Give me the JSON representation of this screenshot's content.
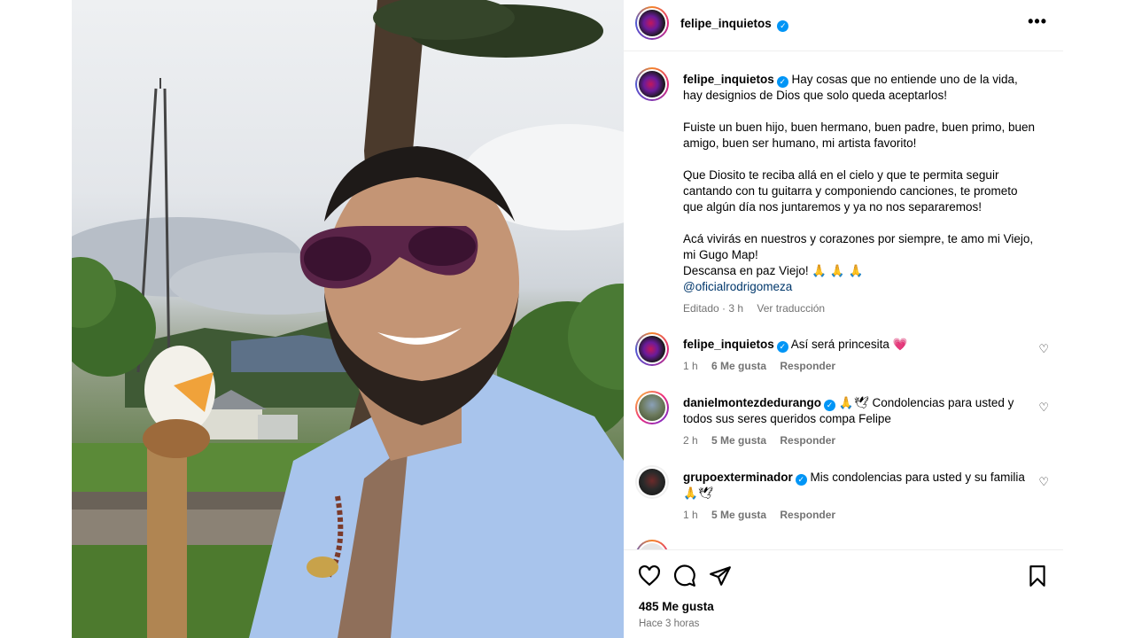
{
  "post": {
    "username": "felipe_inquietos",
    "more_label": "•••"
  },
  "caption": {
    "username": "felipe_inquietos",
    "p1": "Hay cosas que no entiende uno de la vida, hay designios de Dios que solo queda aceptarlos!",
    "p2": "Fuiste un buen hijo, buen hermano, buen padre, buen primo, buen amigo, buen ser humano, mi artista favorito!",
    "p3": "Que Diosito te reciba allá en el cielo y que te permita seguir cantando con tu guitarra y componiendo canciones, te prometo que algún día nos juntaremos y ya no nos separaremos!",
    "p4": "Acá vivirás en nuestros y corazones por siempre, te amo mi Viejo, mi Gugo Map!\nDescansa en paz Viejo! 🙏 🙏 🙏",
    "mention": "@oficialrodrigomeza",
    "edited": "Editado · 3 h",
    "translate": "Ver traducción"
  },
  "comments": [
    {
      "username": "felipe_inquietos",
      "text": "Así será princesita 💗",
      "time": "1 h",
      "likes": "6 Me gusta",
      "reply": "Responder"
    },
    {
      "username": "danielmontezdedurango",
      "text": "🙏🕊 Condolencias para usted y todos sus seres queridos compa Felipe",
      "time": "2 h",
      "likes": "5 Me gusta",
      "reply": "Responder"
    },
    {
      "username": "grupoexterminador",
      "text": "Mis condolencias para usted y su familia 🙏🕊",
      "time": "1 h",
      "likes": "5 Me gusta",
      "reply": "Responder"
    }
  ],
  "footer": {
    "likes": "485 Me gusta",
    "time": "Hace 3 horas"
  },
  "icons": {
    "like": "heart-icon",
    "comment": "comment-icon",
    "share": "share-icon",
    "save": "bookmark-icon"
  },
  "colors": {
    "verified": "#0095f6",
    "mention": "#00376b",
    "muted": "#737373"
  }
}
